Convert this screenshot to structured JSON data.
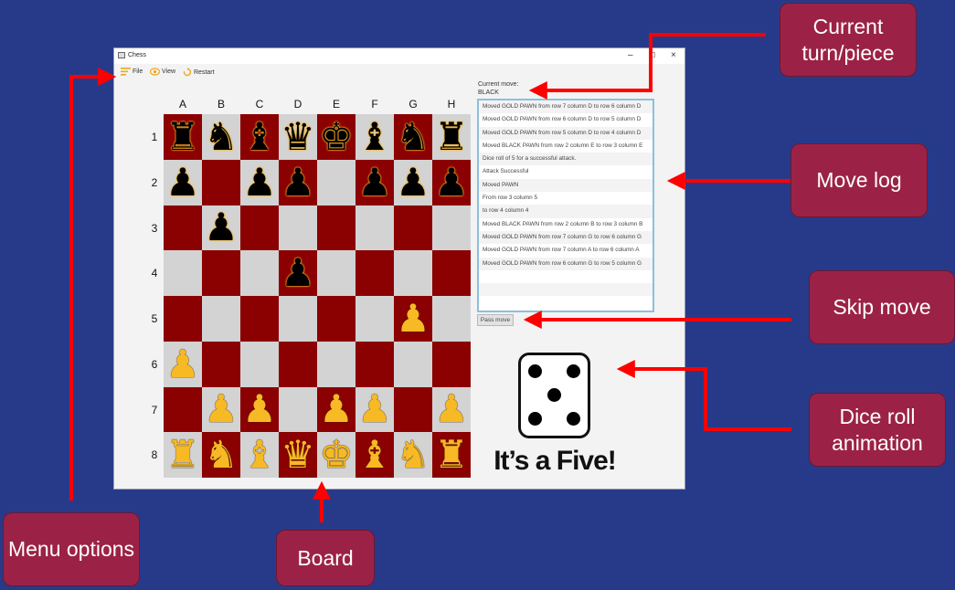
{
  "window": {
    "title": "Chess",
    "controls": [
      "–",
      "☐",
      "×"
    ]
  },
  "menu": [
    {
      "label": "File",
      "icon": "hamburger-icon"
    },
    {
      "label": "View",
      "icon": "eye-icon"
    },
    {
      "label": "Restart",
      "icon": "restart-icon"
    }
  ],
  "board": {
    "columns": [
      "A",
      "B",
      "C",
      "D",
      "E",
      "F",
      "G",
      "H"
    ],
    "rows": [
      "1",
      "2",
      "3",
      "4",
      "5",
      "6",
      "7",
      "8"
    ],
    "pieces": [
      [
        "bR",
        "bN",
        "bB",
        "bQ",
        "bK",
        "bB",
        "bN",
        "bR"
      ],
      [
        "bP",
        "",
        "bP",
        "bP",
        "",
        "bP",
        "bP",
        "bP"
      ],
      [
        "",
        "bP",
        "",
        "",
        "",
        "",
        "",
        ""
      ],
      [
        "",
        "",
        "",
        "bP",
        "",
        "",
        "",
        ""
      ],
      [
        "",
        "",
        "",
        "",
        "",
        "",
        "gP",
        ""
      ],
      [
        "gP",
        "",
        "",
        "",
        "",
        "",
        "",
        ""
      ],
      [
        "",
        "gP",
        "gP",
        "",
        "gP",
        "gP",
        "",
        "gP"
      ],
      [
        "gR",
        "gN",
        "gB",
        "gQ",
        "gK",
        "gB",
        "gN",
        "gR"
      ]
    ],
    "colors": {
      "dark": "#8b0000",
      "light": "#d3d3d3",
      "gold": "#f7b924",
      "black": "#000000"
    }
  },
  "status": {
    "current_move_label": "Current move:",
    "current_move_value": "BLACK"
  },
  "move_log": [
    "Moved GOLD PAWN from row 7 column D to row 6 column D",
    "Moved GOLD PAWN from row 6 column D to row 5 column D",
    "Moved GOLD PAWN from row 5 column D to row 4 column D",
    "Moved BLACK PAWN from row 2 column E to row 3 column E",
    "Dice roll of 5 for a successful attack.",
    "Attack Successful",
    "Moved PAWN",
    " From row 3 column 5",
    " to row 4 column 4",
    "Moved BLACK PAWN from row 2 column B to row 3 column B",
    "Moved GOLD PAWN from row 7 column G to row 6 column G",
    "Moved GOLD PAWN from row 7 column A to row 6 column A",
    "Moved GOLD PAWN from row 6 column G to row 5 column G",
    "",
    "",
    ""
  ],
  "pass_button": "Pass move",
  "dice": {
    "value": 5,
    "caption": "It’s a Five!"
  },
  "callouts": {
    "current": "Current turn/piece",
    "movelog": "Move log",
    "skip": "Skip move",
    "dice": "Dice roll animation",
    "menu": "Menu options",
    "board": "Board"
  },
  "accent_colors": {
    "background": "#273a8a",
    "callout": "#9b2246",
    "arrow": "#ff0000"
  }
}
